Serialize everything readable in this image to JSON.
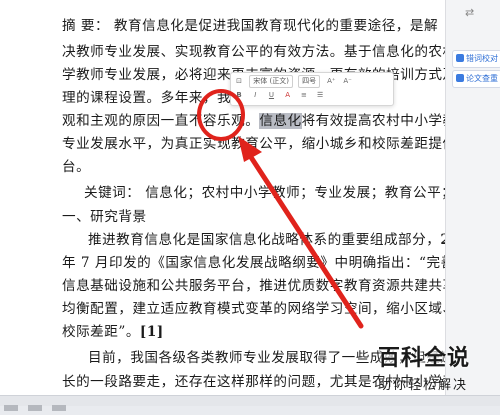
{
  "document": {
    "lines": [
      {
        "text": "摘    要： 教育信息化是促进我国教育现代化的重要途径，是解"
      },
      {
        "text": "决教师专业发展、实现教育公平的有效方法。基于信息化的农村中小"
      },
      {
        "text": "学教师专业发展，必将迎来更丰富的资源、更有效的培训方式及更合"
      },
      {
        "text": "理的课程设置。多年来，我国农村"
      },
      {
        "text_before": "观和主观的原因一直不容乐观。",
        "text_sel": "信息化",
        "text_after": "将有效提高农村中小学教师的"
      },
      {
        "text": "专业发展水平，为真正实现教育公平，缩小城乡和校际差距提供平"
      },
      {
        "text": "台。"
      },
      {
        "text": "关键词： 信息化；农村中小学教师；专业发展；教育公平；"
      },
      {
        "text": "一、研究背景"
      },
      {
        "text_before": "推进教育信息化是国家信息化战略体系的重要组成部分，",
        "text_bold": "2016"
      },
      {
        "text": "年 7 月印发的《国家信息化发展战略纲要》中明确指出：“完善教育"
      },
      {
        "text": "信息基础设施和公共服务平台，推进优质数字教育资源共建共享和"
      },
      {
        "text": "均衡配置，建立适应教育模式变革的网络学习空间，缩小区域、城乡、"
      },
      {
        "text_before": "校际差距”。",
        "text_bold": "[1]"
      },
      {
        "text": "目前，我国各级各类教师专业发展取得了一些成效，但是还存"
      },
      {
        "text": "长的一段路要走，还存在这样那样的问题，尤其是农村中小学教师"
      }
    ]
  },
  "mini_toolbar": {
    "font_name": "宋体 (正文)",
    "font_size": "四号",
    "grow_label": "A⁺",
    "shrink_label": "A⁻",
    "bold_label": "B",
    "italic_label": "I",
    "underline_label": "U",
    "color_label": "A"
  },
  "right_panel": {
    "buttons": [
      {
        "label": "错词校对"
      },
      {
        "label": "论文查重"
      }
    ],
    "toggle_label": "⇄"
  },
  "watermark": {
    "title": "百科全说",
    "subtitle": "助你轻松解决"
  },
  "colors": {
    "arrow": "#e0231c",
    "selection": "#b9bcc4",
    "accent": "#2f6fd6"
  }
}
